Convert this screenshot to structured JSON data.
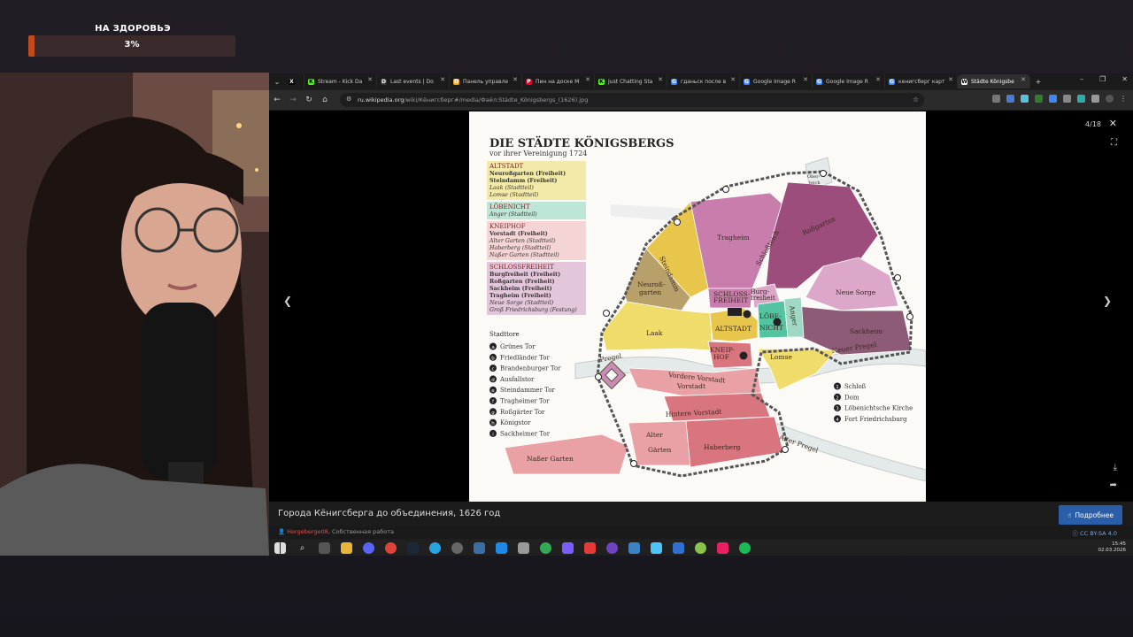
{
  "overlay": {
    "label": "НА ЗДОРОВЬЭ",
    "percent_text": "3%",
    "progress": 0.03
  },
  "tabs": [
    {
      "label": "X",
      "fav": "X",
      "color": "#000000"
    },
    {
      "label": "Stream - Kick Da",
      "fav": "K",
      "color": "#53fc18"
    },
    {
      "label": "Last events | Do",
      "fav": "D",
      "color": "#3a3a3a"
    },
    {
      "label": "Панель управле",
      "fav": "D",
      "color": "#f5a623"
    },
    {
      "label": "Пин на доске M",
      "fav": "P",
      "color": "#e60023"
    },
    {
      "label": "Just Chatting Sta",
      "fav": "K",
      "color": "#53fc18"
    },
    {
      "label": "гданьск после в",
      "fav": "G",
      "color": "#4285f4"
    },
    {
      "label": "Google Image R",
      "fav": "G",
      "color": "#4285f4"
    },
    {
      "label": "Google Image R",
      "fav": "G",
      "color": "#4285f4"
    },
    {
      "label": "кенигсберг карт",
      "fav": "G",
      "color": "#4285f4"
    },
    {
      "label": "Städte Königsbe",
      "fav": "W",
      "color": "#ffffff"
    }
  ],
  "address": {
    "host": "ru.wikipedia.org",
    "path": "/wiki/Кёнигсберг#/media/Файл:Städte_Königsbergs_(1626).jpg"
  },
  "viewer": {
    "counter": "4/18",
    "caption": "Города Кёнигсберга до объединения, 1626 год",
    "more_button": "Подробнее",
    "author": "Hergeberge08",
    "author_note": ", Собственная работа",
    "license": "CC BY-SA 4.0"
  },
  "map": {
    "title": "DIE STÄDTE KÖNIGSBERGS",
    "subtitle": "vor ihrer Vereinigung 1724",
    "legend_groups": [
      {
        "head": "ALTSTADT",
        "color": "#f3e9a8",
        "items": [
          {
            "t": "Neuroßgarten (Freiheit)",
            "i": false
          },
          {
            "t": "Steindamm (Freiheit)",
            "i": false
          },
          {
            "t": "Laak (Stadtteil)",
            "i": true
          },
          {
            "t": "Lomse (Stadtteil)",
            "i": true
          }
        ]
      },
      {
        "head": "LÖBENICHT",
        "color": "#bde6d6",
        "items": [
          {
            "t": "Anger (Stadtteil)",
            "i": true
          }
        ]
      },
      {
        "head": "KNEIPHOF",
        "color": "#f4d4d4",
        "items": [
          {
            "t": "Vorstadt (Freiheit)",
            "i": false
          },
          {
            "t": "Alter Garten (Stadtteil)",
            "i": true
          },
          {
            "t": "Haberberg (Stadtteil)",
            "i": true
          },
          {
            "t": "Naßer Garten (Stadtteil)",
            "i": true
          }
        ]
      },
      {
        "head": "SCHLOSSFREIHEIT",
        "color": "#e3c6d9",
        "items": [
          {
            "t": "Burgfreiheit (Freiheit)",
            "i": false
          },
          {
            "t": "Roßgarten (Freiheit)",
            "i": false
          },
          {
            "t": "Sackheim (Freiheit)",
            "i": false
          },
          {
            "t": "Tragheim (Freiheit)",
            "i": false
          },
          {
            "t": "Neue Sorge (Stadtteil)",
            "i": true
          },
          {
            "t": "Groß Friedrichsburg (Festung)",
            "i": true
          }
        ]
      }
    ],
    "gates_title": "Stadttore",
    "gates": [
      {
        "k": "a",
        "n": "Grünes Tor"
      },
      {
        "k": "b",
        "n": "Friedländer Tor"
      },
      {
        "k": "c",
        "n": "Brandenburger Tor"
      },
      {
        "k": "d",
        "n": "Ausfallstor"
      },
      {
        "k": "e",
        "n": "Steindammer Tor"
      },
      {
        "k": "f",
        "n": "Tragheimer Tor"
      },
      {
        "k": "g",
        "n": "Roßgärter Tor"
      },
      {
        "k": "h",
        "n": "Königstor"
      },
      {
        "k": "i",
        "n": "Sackheimer Tor"
      }
    ],
    "buildings": [
      {
        "k": "1",
        "n": "Schloß"
      },
      {
        "k": "2",
        "n": "Dom"
      },
      {
        "k": "3",
        "n": "Löbenichtsche Kirche"
      },
      {
        "k": "4",
        "n": "Fort Friedrichsburg"
      }
    ],
    "districts": {
      "tragheim": "Tragheim",
      "rossgarten": "Roßgarten",
      "steindamm": "Steindamm",
      "neurossgarten": "Neuroß-",
      "neurossgarten2": "garten",
      "oberteich": "Ober-",
      "oberteich2": "teich",
      "schloss": "SCHLOSS-",
      "schloss2": "FREIHEIT",
      "burg": "Burg-",
      "burg2": "freiheit",
      "loeb": "LÖBE-",
      "loeb2": "NICHT",
      "anger": "Anger",
      "neuesorge": "Neue Sorge",
      "sackheim": "Sackheim",
      "laak": "Laak",
      "altstadt": "ALTSTADT",
      "kneip": "KNEIP-",
      "kneip2": "HOF",
      "lomse": "Lomse",
      "pregel1": "Pregel",
      "neuepregel": "Neuer Pregel",
      "vorstadt": "Vorstadt",
      "vordere": "Vordere Vorstadt",
      "hintere": "Hintere Vorstadt",
      "alter": "Alter",
      "alter2": "Gärten",
      "haberberg": "Haberberg",
      "nasser": "Naßer Garten",
      "alterpregel": "Alter Pregel",
      "schlossteich": "Schloßteich"
    },
    "colors": {
      "altstadt": "#f0dc6a",
      "altstadt_dark": "#e8c64c",
      "loebenicht": "#52c4a2",
      "kneiphof": "#e9a1a6",
      "kneiphof_dark": "#d9757e",
      "tragheim": "#c97dac",
      "rossgarten": "#9c4d7c",
      "sackheim": "#8e5b76",
      "neuesorge": "#dca7c8",
      "neurossgarten": "#b8a06a",
      "water": "#e8ecec"
    }
  }
}
